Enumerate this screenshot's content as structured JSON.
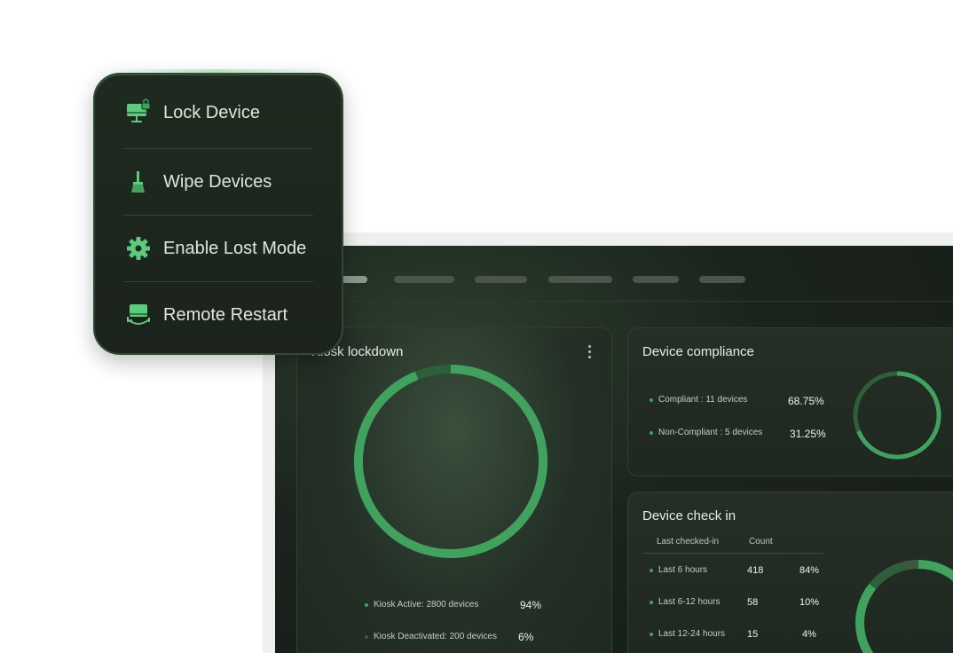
{
  "menu": {
    "items": [
      {
        "label": "Lock Device",
        "icon": "monitor-lock-icon"
      },
      {
        "label": "Wipe Devices",
        "icon": "broom-icon"
      },
      {
        "label": "Enable Lost Mode",
        "icon": "gear-icon"
      },
      {
        "label": "Remote Restart",
        "icon": "monitor-restart-icon"
      }
    ]
  },
  "colors": {
    "accent": "#3fa35d",
    "accent_light": "#5ccb7a",
    "accent_dim": "#2e5f3b",
    "panel": "#1f2820"
  },
  "kiosk": {
    "title": "Kiosk lockdown",
    "legend": [
      {
        "label": "Kiosk Active: 2800  devices",
        "value": "94%",
        "color": "#3fa35d"
      },
      {
        "label": "Kiosk Deactivated: 200 devices",
        "value": "6%",
        "color": "#2e5f3b"
      }
    ]
  },
  "compliance": {
    "title": "Device compliance",
    "legend": [
      {
        "label": "Compliant : 11 devices",
        "value": "68.75%",
        "color": "#3fa35d"
      },
      {
        "label": "Non-Compliant : 5 devices",
        "value": "31.25%",
        "color": "#3fa35d"
      }
    ]
  },
  "checkin": {
    "title": "Device check in",
    "columns": [
      "Last checked-in",
      "Count"
    ],
    "rows": [
      {
        "label": "Last 6 hours",
        "count": "418",
        "pct": "84%"
      },
      {
        "label": "Last 6-12 hours",
        "count": "58",
        "pct": "10%"
      },
      {
        "label": "Last 12-24 hours",
        "count": "15",
        "pct": "4%"
      }
    ]
  },
  "chart_data": [
    {
      "type": "pie",
      "categories": [
        "Kiosk Active",
        "Kiosk Deactivated"
      ],
      "values": [
        94,
        6
      ]
    },
    {
      "type": "pie",
      "categories": [
        "Compliant",
        "Non-Compliant"
      ],
      "values": [
        68.75,
        31.25
      ]
    },
    {
      "type": "pie",
      "categories": [
        "Last 6 hours",
        "Last 6-12 hours",
        "Last 12-24 hours"
      ],
      "values": [
        84,
        10,
        4
      ]
    }
  ]
}
